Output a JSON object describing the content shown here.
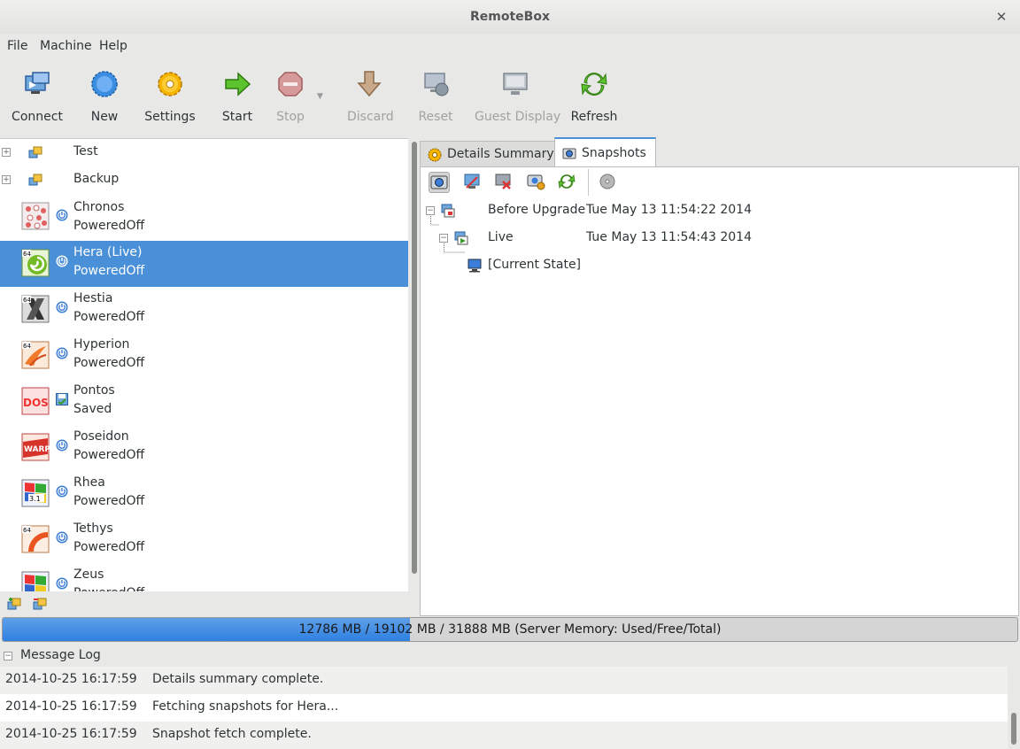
{
  "window": {
    "title": "RemoteBox"
  },
  "menu": [
    "File",
    "Machine",
    "Help"
  ],
  "toolbar": {
    "connect": "Connect",
    "new": "New",
    "settings": "Settings",
    "start": "Start",
    "stop": "Stop",
    "discard": "Discard",
    "reset": "Reset",
    "guest_display": "Guest Display",
    "refresh": "Refresh"
  },
  "vm_list": {
    "groups": [
      {
        "name": "Test"
      },
      {
        "name": "Backup"
      }
    ],
    "machines": [
      {
        "name": "Chronos",
        "state": "PoweredOff",
        "os_icon": "other-os-icon"
      },
      {
        "name": "Hera (Live)",
        "state": "PoweredOff",
        "os_icon": "opensuse-64-icon",
        "selected": true
      },
      {
        "name": "Hestia",
        "state": "PoweredOff",
        "os_icon": "macos-x-64-icon"
      },
      {
        "name": "Hyperion",
        "state": "PoweredOff",
        "os_icon": "solaris-64-icon"
      },
      {
        "name": "Pontos",
        "state": "Saved",
        "os_icon": "dos-icon"
      },
      {
        "name": "Poseidon",
        "state": "PoweredOff",
        "os_icon": "os2-warp-icon"
      },
      {
        "name": "Rhea",
        "state": "PoweredOff",
        "os_icon": "windows-31-icon"
      },
      {
        "name": "Tethys",
        "state": "PoweredOff",
        "os_icon": "ubuntu-64-icon"
      },
      {
        "name": "Zeus",
        "state": "PoweredOff",
        "os_icon": "windows-xp-icon"
      }
    ]
  },
  "tabs": [
    {
      "label": "Details Summary",
      "icon": "gear-icon"
    },
    {
      "label": "Snapshots",
      "icon": "camera-icon",
      "active": true
    }
  ],
  "snapshots": [
    {
      "name": "Before Upgrade",
      "date": "Tue May 13 11:54:22 2014"
    },
    {
      "name": "Live",
      "date": "Tue May 13 11:54:43 2014"
    },
    {
      "name": "[Current State]",
      "date": ""
    }
  ],
  "memory": {
    "text": "12786 MB / 19102 MB / 31888 MB (Server Memory: Used/Free/Total)",
    "used_fraction": 0.401
  },
  "message_log": {
    "title": "Message Log",
    "entries": [
      {
        "time": "2014-10-25 16:17:59",
        "message": "Details summary complete."
      },
      {
        "time": "2014-10-25 16:17:59",
        "message": "Fetching snapshots for Hera..."
      },
      {
        "time": "2014-10-25 16:17:59",
        "message": "Snapshot fetch complete."
      }
    ]
  },
  "colors": {
    "selection": "#4a90d9",
    "memory_fill": "#3584e4"
  }
}
